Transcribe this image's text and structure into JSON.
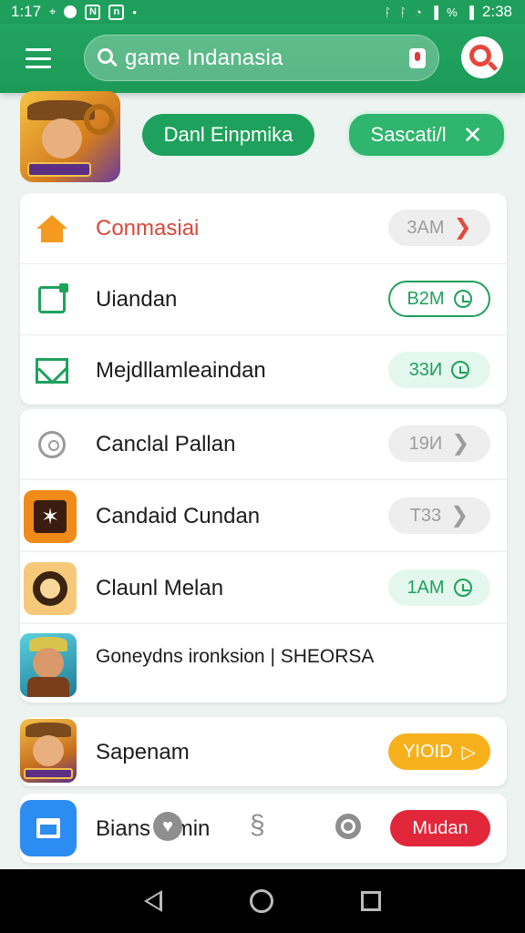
{
  "status_bar": {
    "time_left": "1:17",
    "icons_left": [
      "location-icon",
      "n-icon",
      "n-icon"
    ],
    "percent_label": "%",
    "time": "2:38"
  },
  "app_bar": {
    "menu_icon": "hamburger-icon",
    "search": {
      "value": "game Indanasia"
    },
    "accent": "#1ea15c"
  },
  "header": {
    "primary_button": "Danl Einpmika",
    "secondary_button": "Sascati/l",
    "close_glyph": "✕"
  },
  "list": [
    {
      "icon": "home-icon",
      "label": "Conmasiai",
      "chip": "3AМ",
      "chip_style": "grey",
      "indicator": "chevron"
    },
    {
      "icon": "edit-icon",
      "label": "Uiandan",
      "chip": "B2М",
      "chip_style": "green-outline",
      "indicator": "clock"
    },
    {
      "icon": "mail-icon",
      "label": "Mejdllamleaindan",
      "chip": "33И",
      "chip_style": "green",
      "indicator": "clock"
    },
    {
      "icon": "pin-icon",
      "label": "Canclal Pallan",
      "chip": "19И",
      "chip_style": "grey",
      "indicator": "chevron"
    },
    {
      "icon": "star-tile-icon",
      "label": "Candaid Cundan",
      "chip": "T33",
      "chip_style": "grey",
      "indicator": "chevron"
    },
    {
      "icon": "ring-tile-icon",
      "label": "Claunl Melan",
      "chip": "1AМ",
      "chip_style": "green",
      "indicator": "clock"
    },
    {
      "icon": "character-tile-icon",
      "label": "Goneydns ironksion | SHEORSA"
    },
    {
      "icon": "character-tile-icon",
      "label": "Sapenam",
      "chip": "YIOID",
      "chip_style": "yellow",
      "indicator": "play"
    },
    {
      "icon": "gift-tile-icon",
      "label": "Bians    min",
      "chip": "Mudan",
      "chip_style": "red"
    }
  ],
  "glyphs": {
    "chevron": "❯",
    "play": "▷",
    "ghost_heart": "♥",
    "link": "§"
  }
}
